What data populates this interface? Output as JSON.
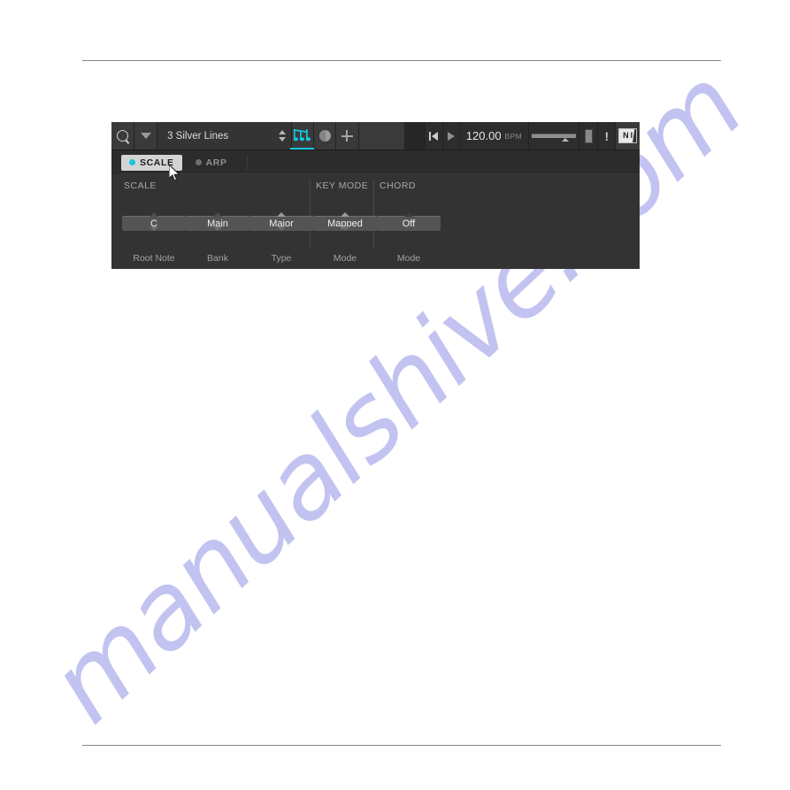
{
  "watermark": {
    "text": "manualshive.com"
  },
  "toolbar": {
    "search_icon": "search-icon",
    "browser_arrow_icon": "chevron-down-icon",
    "preset_name": "3 Silver Lines",
    "stepper_icon": "up-down-stepper-icon",
    "notes_icon": "musical-notes-icon",
    "sampling_icon": "circle-sound-icon",
    "add_icon": "plus-icon",
    "blank_field": "",
    "rewind_icon": "rewind-to-start-icon",
    "play_icon": "play-icon",
    "tempo_value": "120.00",
    "tempo_unit": "BPM",
    "fader_icon": "master-volume-fader",
    "meter_icon": "level-meter-icon",
    "warning_icon": "!",
    "logo_n": "N",
    "logo_i": "I",
    "logo_name": "native-instruments-logo"
  },
  "tabs": [
    {
      "label": "SCALE",
      "active": true,
      "dot_color": "#15c6e0"
    },
    {
      "label": "ARP",
      "active": false,
      "dot_color": "#6e6e6e"
    }
  ],
  "groups": [
    {
      "title": "SCALE"
    },
    {
      "title": "KEY MODE"
    },
    {
      "title": "CHORD"
    }
  ],
  "controls": [
    {
      "value": "C",
      "label": "Root Note",
      "up_state": "normal",
      "down_state": "normal"
    },
    {
      "value": "Main",
      "label": "Bank",
      "up_state": "normal",
      "down_state": "normal"
    },
    {
      "value": "Major",
      "label": "Type",
      "up_state": "bright",
      "down_state": "normal"
    },
    {
      "value": "Mapped",
      "label": "Mode",
      "up_state": "bright",
      "down_state": "normal"
    },
    {
      "value": "Off",
      "label": "Mode",
      "up_state": "dim",
      "down_state": "normal"
    }
  ],
  "colors": {
    "accent_cyan": "#15c6e0",
    "window_bg": "#2c2c2c",
    "controls_bg": "#333333",
    "value_button": "#545454",
    "watermark": "#b9b9ef"
  }
}
